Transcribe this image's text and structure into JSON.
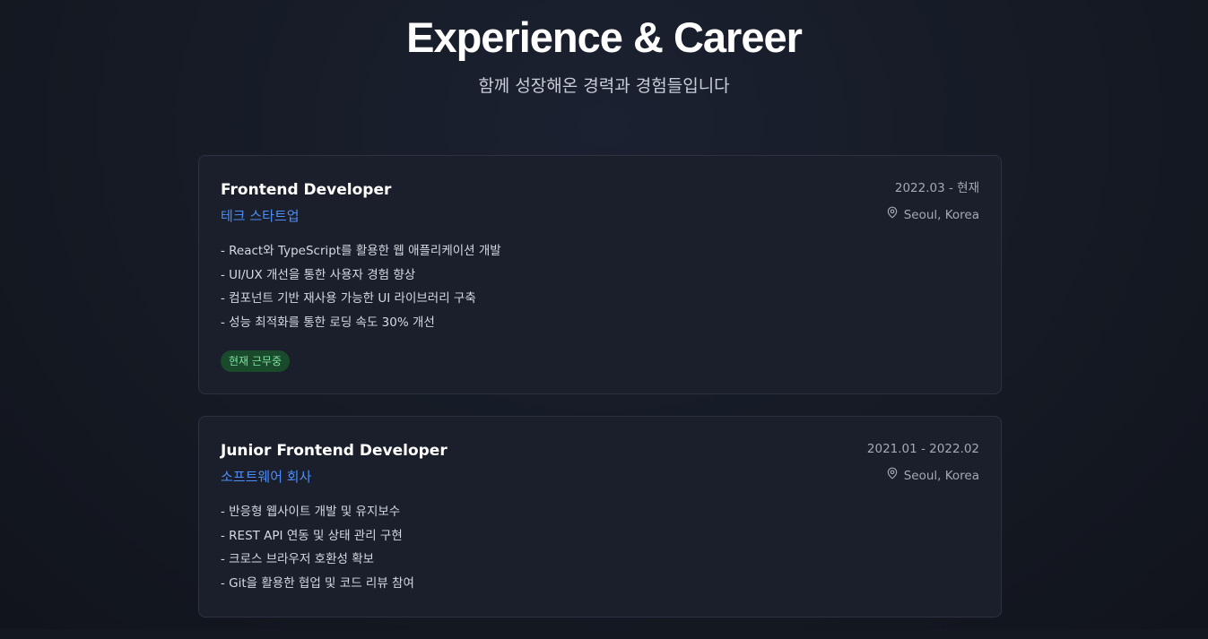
{
  "header": {
    "title": "Experience & Career",
    "subtitle": "함께 성장해온 경력과 경험들입니다"
  },
  "experiences": [
    {
      "role": "Frontend Developer",
      "company": "테크 스타트업",
      "period": "2022.03 - 현재",
      "location": "Seoul, Korea",
      "bullets": [
        "- React와 TypeScript를 활용한 웹 애플리케이션 개발",
        "- UI/UX 개선을 통한 사용자 경험 향상",
        "- 컴포넌트 기반 재사용 가능한 UI 라이브러리 구축",
        "- 성능 최적화를 통한 로딩 속도 30% 개선"
      ],
      "badge": "현재 근무중"
    },
    {
      "role": "Junior Frontend Developer",
      "company": "소프트웨어 회사",
      "period": "2021.01 - 2022.02",
      "location": "Seoul, Korea",
      "bullets": [
        "- 반응형 웹사이트 개발 및 유지보수",
        "- REST API 연동 및 상태 관리 구현",
        "- 크로스 브라우저 호환성 확보",
        "- Git을 활용한 협업 및 코드 리뷰 참여"
      ]
    }
  ],
  "colors": {
    "accent": "#4d8df5",
    "badge_bg": "#1a4a2c",
    "badge_text": "#7fe3a1",
    "background": "#141821",
    "card": "#1a1f2b"
  },
  "icons": {
    "location": "map-pin-icon"
  }
}
